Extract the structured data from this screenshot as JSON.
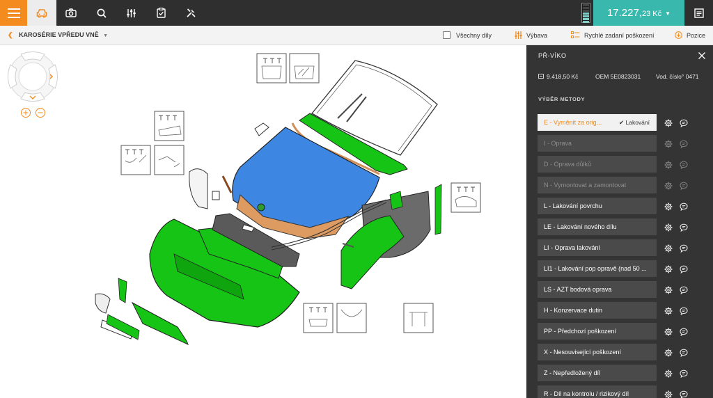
{
  "topbar": {
    "icons": [
      "menu-icon",
      "car-icon",
      "camera-icon",
      "search-icon",
      "sliders-icon",
      "clipboard-check-icon",
      "tools-icon",
      "notes-icon"
    ],
    "price_main": "17.227,",
    "price_dec": "23 Kč",
    "accent": "#f38b1f",
    "teal": "#39b8ad"
  },
  "subbar": {
    "crumb": "KAROSÉRIE VPŘEDU VNĚ",
    "all_parts": "Všechny díly",
    "equipment": "Výbava",
    "quick_damage": "Rychlé zadaní poškození",
    "position": "Pozice"
  },
  "panel": {
    "title": "PŘ-VÍKO",
    "price": "9.418,50 Kč",
    "oem": "OEM 5E0823031",
    "water_no": "Vod. číslo° 0471",
    "section": "VÝBĚR METODY",
    "selected_tag": "Lakování",
    "methods": [
      {
        "label": "E - Vyměnit za orig...",
        "state": "selected"
      },
      {
        "label": "I - Oprava",
        "state": "disabled"
      },
      {
        "label": "D - Oprava důlků",
        "state": "disabled"
      },
      {
        "label": "N - Vymontovat a zamontovat",
        "state": "disabled"
      },
      {
        "label": "L - Lakování povrchu",
        "state": "normal"
      },
      {
        "label": "LE - Lakování nového dílu",
        "state": "normal"
      },
      {
        "label": "LI - Oprava lakování",
        "state": "normal"
      },
      {
        "label": "LI1 - Lakování pop opravě (nad 50 ...",
        "state": "normal"
      },
      {
        "label": "LS - AZT bodová oprava",
        "state": "normal"
      },
      {
        "label": "H - Konzervace dutin",
        "state": "normal"
      },
      {
        "label": "PP - Předchozí poškození",
        "state": "normal"
      },
      {
        "label": "X - Nesouvisející poškození",
        "state": "normal"
      },
      {
        "label": "Z - Nepředložený díl",
        "state": "normal"
      },
      {
        "label": "R - Díl na kontrolu / rizikový díl",
        "state": "normal"
      }
    ]
  }
}
